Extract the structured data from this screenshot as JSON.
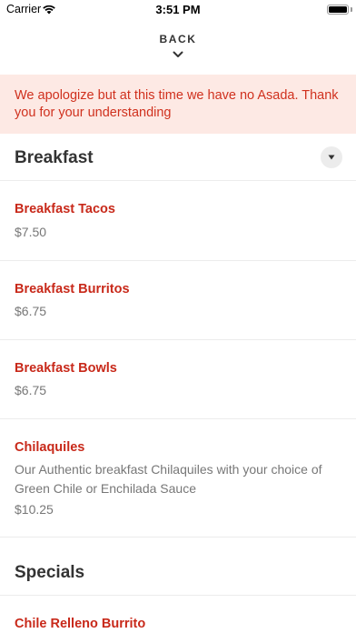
{
  "status_bar": {
    "carrier": "Carrier",
    "time": "3:51 PM"
  },
  "nav": {
    "back_label": "BACK"
  },
  "notice": {
    "text": "We apologize but at this time we have no Asada. Thank you for your understanding"
  },
  "sections": [
    {
      "title": "Breakfast",
      "items": [
        {
          "name": "Breakfast Tacos",
          "price": "$7.50"
        },
        {
          "name": "Breakfast Burritos",
          "price": "$6.75"
        },
        {
          "name": "Breakfast Bowls",
          "price": "$6.75"
        },
        {
          "name": "Chilaquiles",
          "description": "Our Authentic breakfast Chilaquiles with your choice of Green Chile or Enchilada Sauce",
          "price": "$10.25"
        }
      ]
    },
    {
      "title": "Specials",
      "items": [
        {
          "name": "Chile Relleno Burrito"
        }
      ]
    }
  ],
  "colors": {
    "accent": "#c8291a",
    "notice_bg": "#fde9e4",
    "notice_text": "#d0311e",
    "muted_text": "#777777"
  },
  "icons": {
    "wifi": "wifi-icon",
    "battery": "battery-icon",
    "back": "chevron-down-icon",
    "toggle": "caret-down-icon"
  }
}
